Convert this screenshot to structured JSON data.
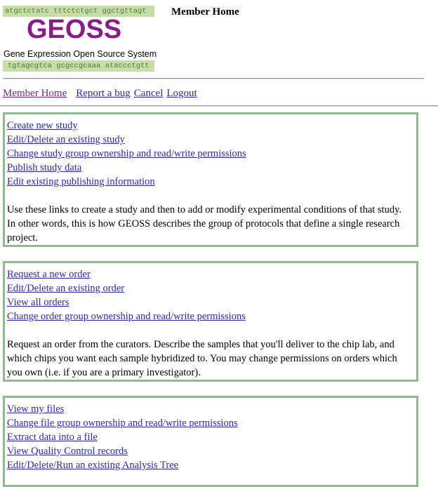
{
  "logo": {
    "dna_top": "atgctctatc tttctctgct ggctgttagt",
    "wordmark": "GEOSS",
    "subtitle": "Gene Expression Open Source System",
    "dna_bottom": "tgtagcgtca gcgccgcaaa ataccctgtt",
    "colors": {
      "strip": "#c6dea6",
      "wordmark": "#8a1c8a"
    }
  },
  "page_heading": "Member Home",
  "nav": {
    "member_home": "Member Home",
    "report_bug": "Report a bug",
    "cancel": "Cancel",
    "logout": "Logout"
  },
  "study_panel": {
    "links": [
      "Create new study",
      "Edit/Delete an existing study",
      "Change study group ownership and read/write permissions",
      "Publish study data",
      "Edit existing publishing information "
    ],
    "description": "Use these links to create a study and then to add or modify experimental conditions of that study. In other words, this is how GEOSS describes the group of protocols that define a single research project."
  },
  "orders_panel": {
    "links": [
      "Request a new order",
      "Edit/Delete an existing order",
      "View all orders",
      "Change order group ownership and read/write permissions"
    ],
    "description": "Request an order from the curators. Describe the samples that you'll deliver to the chip lab, and which chips you want each sample hybridized to. You may change permissions on orders which you own (i.e. if you are a primary investigator)."
  },
  "files_panel": {
    "links": [
      "View my files",
      "Change file group ownership and read/write permissions",
      "Extract data into a file",
      "View Quality Control records",
      "Edit/Delete/Run an existing Analysis Tree"
    ]
  },
  "colors": {
    "link": "#2a2aa8",
    "visited_link": "#6a2a8a",
    "panel_border": "#8fbc8f"
  }
}
